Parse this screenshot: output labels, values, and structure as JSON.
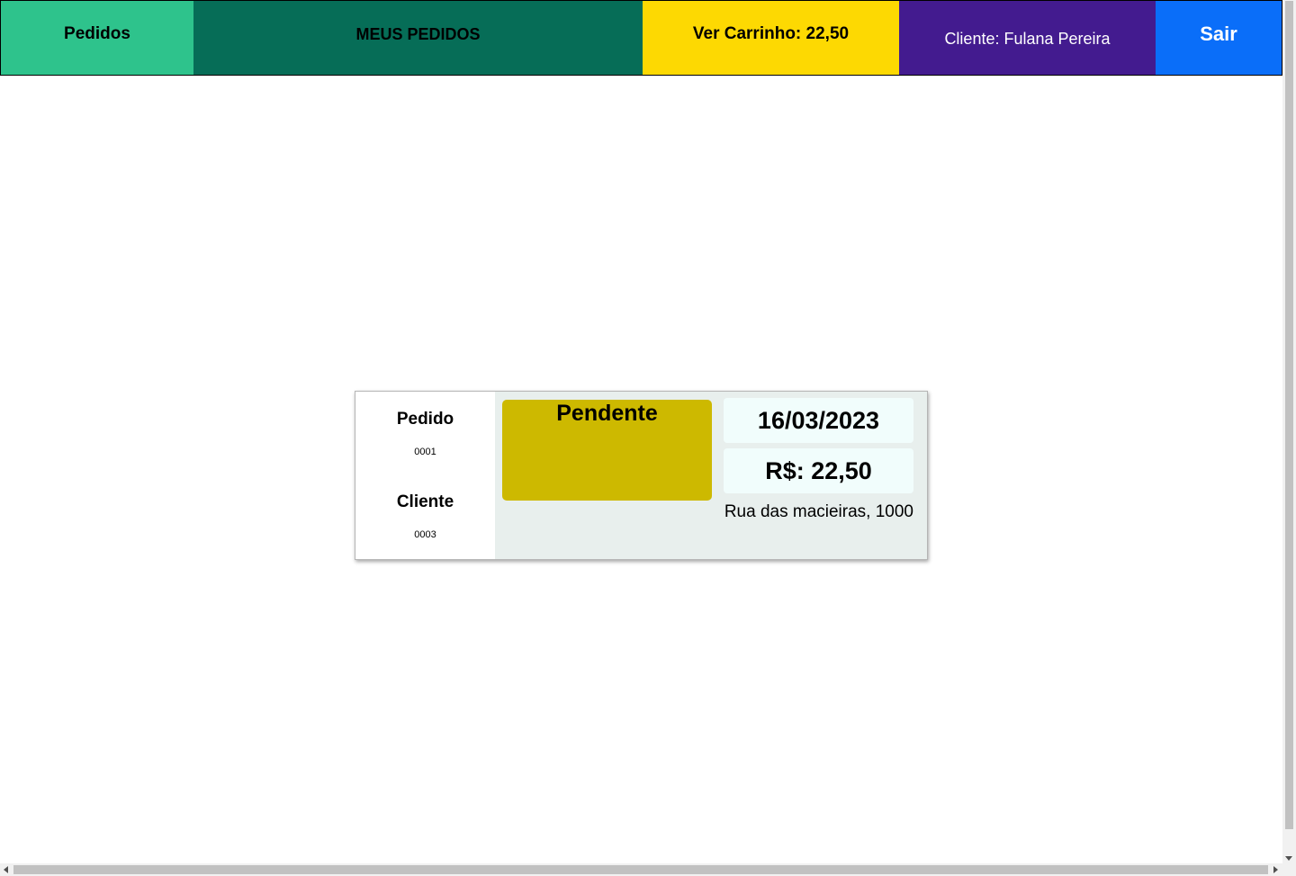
{
  "navbar": {
    "pedidos": "Pedidos",
    "meus_pedidos": "MEUS PEDIDOS",
    "carrinho": "Ver Carrinho: 22,50",
    "cliente": "Cliente: Fulana Pereira",
    "sair": "Sair",
    "colors": {
      "pedidos": "#2ec38c",
      "meus_pedidos": "#066d57",
      "carrinho": "#fdd902",
      "cliente": "#431b8f",
      "sair": "#0a6ef9"
    }
  },
  "order": {
    "pedido_label": "Pedido",
    "pedido_value": "0001",
    "cliente_label": "Cliente",
    "cliente_value": "0003",
    "status": "Pendente",
    "status_color": "#cdb900",
    "date": "16/03/2023",
    "total": "R$: 22,50",
    "address": "Rua das macieiras, 1000"
  }
}
